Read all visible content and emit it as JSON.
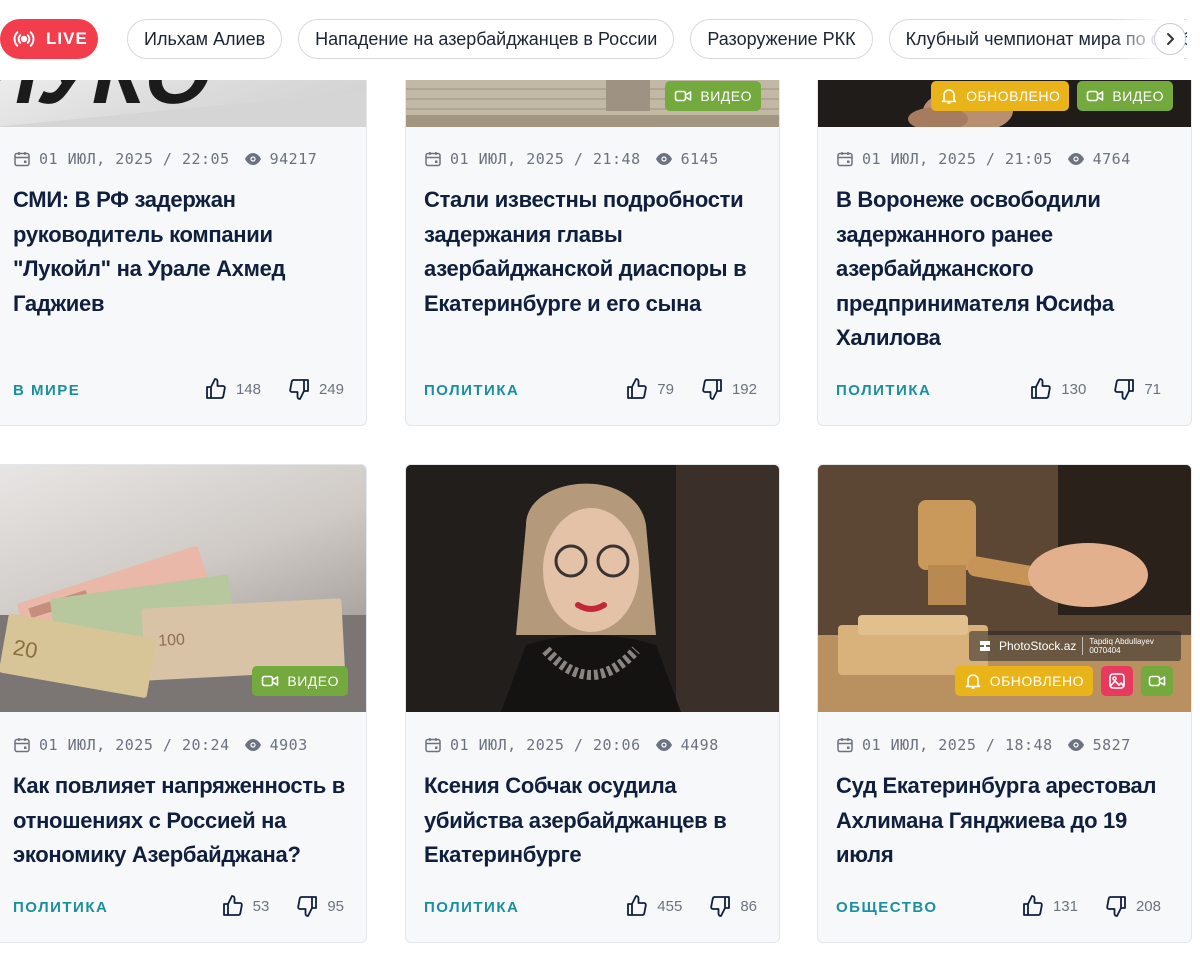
{
  "topbar": {
    "live_label": "LIVE",
    "chips": [
      "Ильхам Алиев",
      "Нападение на азербайджанцев в России",
      "Разоружение РКК",
      "Клубный чемпионат мира по футболу"
    ]
  },
  "colors": {
    "live": "#f23d4c",
    "category": "#1a8f9e",
    "video_badge": "#74a93e",
    "updated_badge": "#e9b419",
    "gallery_badge": "#e83a5e"
  },
  "cards": [
    {
      "date": "01 ИЮЛ, 2025 / 22:05",
      "views": "94217",
      "title_lines": [
        "СМИ: В РФ задержан",
        "руководитель компании",
        "\"Лукойл\" на Урале Ахмед",
        "Гаджиев"
      ],
      "category": "В МИРЕ",
      "likes": "148",
      "dislikes": "249",
      "thumb_caption": "ЛУКО"
    },
    {
      "date": "01 ИЮЛ, 2025 / 21:48",
      "views": "6145",
      "title_lines": [
        "Стали известны подробности",
        "задержания главы",
        "азербайджанской диаспоры в",
        "Екатеринбурге и его сына"
      ],
      "category": "ПОЛИТИКА",
      "likes": "79",
      "dislikes": "192",
      "badges": {
        "video": "ВИДЕО"
      }
    },
    {
      "date": "01 ИЮЛ, 2025 / 21:05",
      "views": "4764",
      "title_lines": [
        "В Воронеже освободили",
        "задержанного ранее",
        "азербайджанского",
        "предпринимателя Юсифа",
        "Халилова"
      ],
      "category": "ПОЛИТИКА",
      "likes": "130",
      "dislikes": "71",
      "badges": {
        "updated": "ОБНОВЛЕНО",
        "video": "ВИДЕО"
      }
    },
    {
      "date": "01 ИЮЛ, 2025 / 20:24",
      "views": "4903",
      "title_lines": [
        "Как повлияет напряженность в",
        "отношениях с Россией на",
        "экономику Азербайджана?"
      ],
      "category": "ПОЛИТИКА",
      "likes": "53",
      "dislikes": "95",
      "badges": {
        "video": "ВИДЕО"
      }
    },
    {
      "date": "01 ИЮЛ, 2025 / 20:06",
      "views": "4498",
      "title_lines": [
        "Ксения Собчак осудила",
        "убийства азербайджанцев в",
        "Екатеринбурге"
      ],
      "category": "ПОЛИТИКА",
      "likes": "455",
      "dislikes": "86"
    },
    {
      "date": "01 ИЮЛ, 2025 / 18:48",
      "views": "5827",
      "title_lines": [
        "Суд Екатеринбурга арестовал",
        "Ахлимана Гянджиева до 19",
        "июля"
      ],
      "category": "ОБЩЕСТВО",
      "likes": "131",
      "dislikes": "208",
      "badges": {
        "updated": "ОБНОВЛЕНО"
      },
      "watermark": {
        "brand": "PhotoStock.az",
        "author": "Tapdiq Abdullayev",
        "code": "0070404"
      }
    }
  ]
}
